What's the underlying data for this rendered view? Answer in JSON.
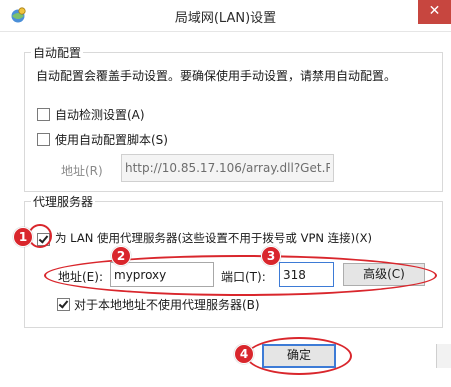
{
  "window": {
    "title": "局域网(LAN)设置",
    "close_symbol": "✕"
  },
  "auto_config": {
    "group_label": "自动配置",
    "description": "自动配置会覆盖手动设置。要确保使用手动设置，请禁用自动配置。",
    "auto_detect": {
      "label": "自动检测设置(A)",
      "checked": false
    },
    "use_script": {
      "label": "使用自动配置脚本(S)",
      "checked": false
    },
    "address_label": "地址(R)",
    "address_value": "http://10.85.17.106/array.dll?Get.Rou"
  },
  "proxy": {
    "group_label": "代理服务器",
    "use_proxy": {
      "label": "为 LAN 使用代理服务器(这些设置不用于拨号或 VPN 连接)(X)",
      "checked": true
    },
    "address_label": "地址(E):",
    "address_value": "myproxy",
    "port_label": "端口(T):",
    "port_value": "318",
    "advanced_label": "高级(C)",
    "bypass_local": {
      "label": "对于本地地址不使用代理服务器(B)",
      "checked": true
    }
  },
  "footer": {
    "ok_label": "确定"
  },
  "annotations": {
    "badge_1": "1",
    "badge_2": "2",
    "badge_3": "3",
    "badge_4": "4",
    "color": "#d9262c"
  }
}
